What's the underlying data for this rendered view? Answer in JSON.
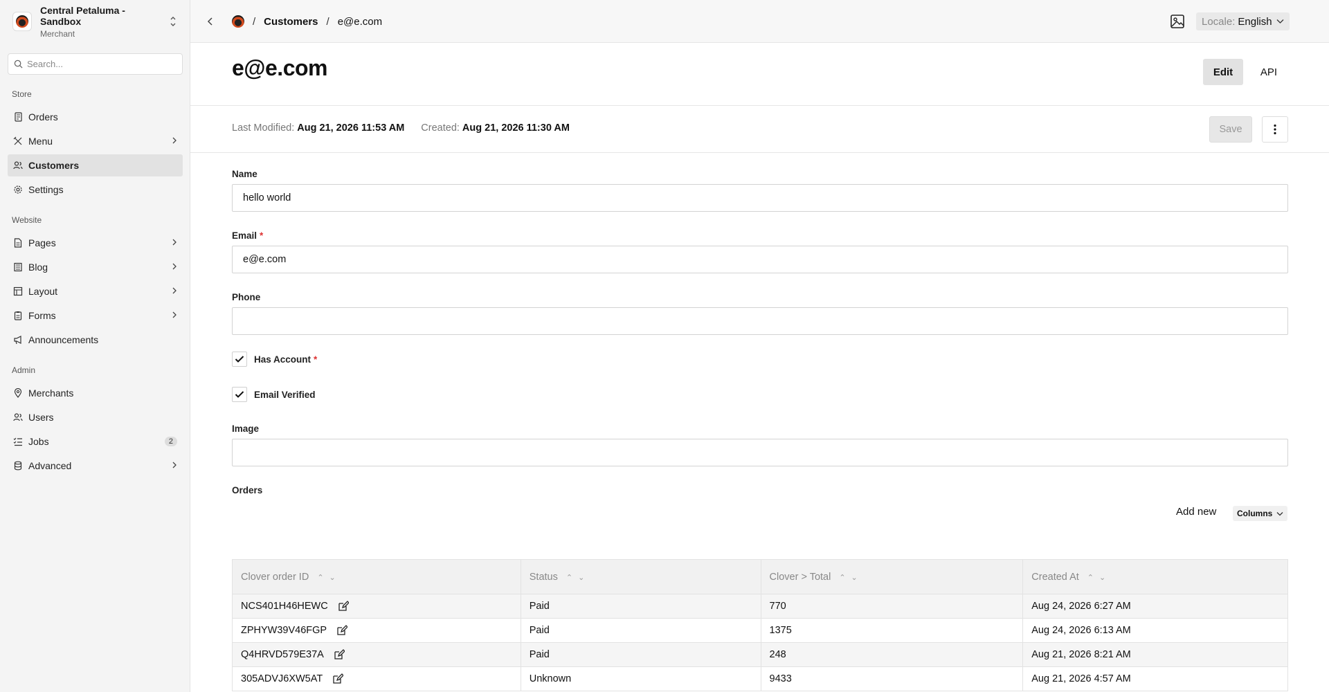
{
  "org": {
    "name": "Central Petaluma - Sandbox",
    "role": "Merchant"
  },
  "search": {
    "placeholder": "Search..."
  },
  "sidebar": {
    "store_label": "Store",
    "website_label": "Website",
    "admin_label": "Admin",
    "items": [
      {
        "label": "Orders"
      },
      {
        "label": "Menu"
      },
      {
        "label": "Customers"
      },
      {
        "label": "Settings"
      },
      {
        "label": "Pages"
      },
      {
        "label": "Blog"
      },
      {
        "label": "Layout"
      },
      {
        "label": "Forms"
      },
      {
        "label": "Announcements"
      },
      {
        "label": "Merchants"
      },
      {
        "label": "Users"
      },
      {
        "label": "Jobs",
        "badge": "2"
      },
      {
        "label": "Advanced"
      }
    ]
  },
  "breadcrumb": {
    "sep": "/",
    "parent": "Customers",
    "current": "e@e.com"
  },
  "locale": {
    "key": "Locale:",
    "value": "English"
  },
  "page": {
    "title": "e@e.com",
    "edit_tab": "Edit",
    "api_tab": "API"
  },
  "meta": {
    "modified_label": "Last Modified:",
    "modified_value": "Aug 21, 2026 11:53 AM",
    "created_label": "Created:",
    "created_value": "Aug 21, 2026 11:30 AM"
  },
  "actions": {
    "save": "Save"
  },
  "form": {
    "name_label": "Name",
    "name_value": "hello world",
    "email_label": "Email",
    "email_value": "e@e.com",
    "phone_label": "Phone",
    "phone_value": "",
    "has_account_label": "Has Account",
    "email_verified_label": "Email Verified",
    "image_label": "Image",
    "required_mark": "*"
  },
  "orders": {
    "label": "Orders",
    "add_new": "Add new",
    "columns": "Columns",
    "headers": [
      "Clover order ID",
      "Status",
      "Clover > Total",
      "Created At"
    ],
    "rows": [
      {
        "id": "NCS401H46HEWC",
        "status": "Paid",
        "total": "770",
        "created": "Aug 24, 2026 6:27 AM"
      },
      {
        "id": "ZPHYW39V46FGP",
        "status": "Paid",
        "total": "1375",
        "created": "Aug 24, 2026 6:13 AM"
      },
      {
        "id": "Q4HRVD579E37A",
        "status": "Paid",
        "total": "248",
        "created": "Aug 21, 2026 8:21 AM"
      },
      {
        "id": "305ADVJ6XW5AT",
        "status": "Unknown",
        "total": "9433",
        "created": "Aug 21, 2026 4:57 AM"
      }
    ]
  }
}
